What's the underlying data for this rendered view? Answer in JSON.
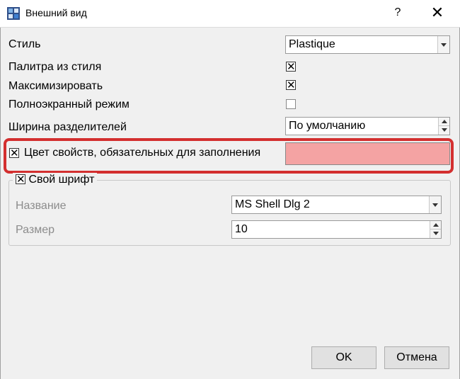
{
  "window": {
    "title": "Внешний вид",
    "help_label": "?",
    "close_label": "✕"
  },
  "settings": {
    "style_label": "Стиль",
    "style_value": "Plastique",
    "palette_label": "Палитра из стиля",
    "palette_checked": true,
    "maximize_label": "Максимизировать",
    "maximize_checked": true,
    "fullscreen_label": "Полноэкранный режим",
    "fullscreen_checked": false,
    "splitter_label": "Ширина разделителей",
    "splitter_value": "По умолчанию",
    "required_color_label": "Цвет свойств, обязательных для заполнения",
    "required_color_checked": true,
    "required_color": "#f4a3a3"
  },
  "font_group": {
    "title": "Свой шрифт",
    "checked": true,
    "name_label": "Название",
    "name_value": "MS Shell Dlg 2",
    "size_label": "Размер",
    "size_value": "10"
  },
  "buttons": {
    "ok_label": "OK",
    "cancel_label": "Отмена"
  },
  "colors": {
    "highlight": "#d32f2f"
  }
}
